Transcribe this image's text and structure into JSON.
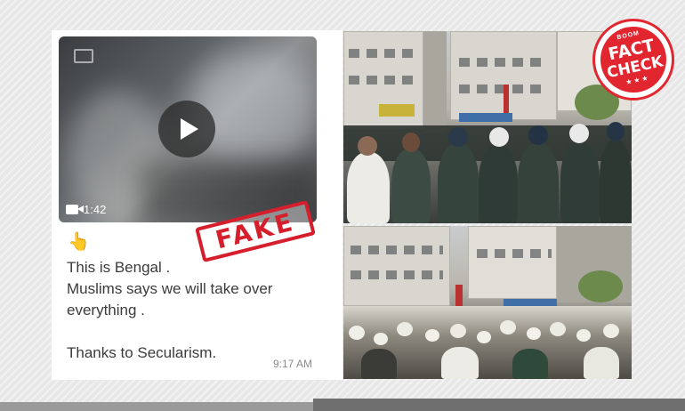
{
  "message": {
    "video_duration": "1:42",
    "emoji": "👆",
    "lines": [
      "This is Bengal .",
      "Muslims says we will take over",
      "everything ."
    ],
    "closing_line": "Thanks to Secularism.",
    "time": "9:17 AM"
  },
  "stamp": {
    "label": "FAKE",
    "color": "#d61f2c"
  },
  "badge": {
    "brand": "BOOM",
    "word_1": "FACT",
    "word_2": "CHECK",
    "stars": "★★★",
    "color": "#e2262f"
  },
  "icons": [
    "play-icon",
    "video-camera-icon",
    "pointing-up-emoji"
  ]
}
